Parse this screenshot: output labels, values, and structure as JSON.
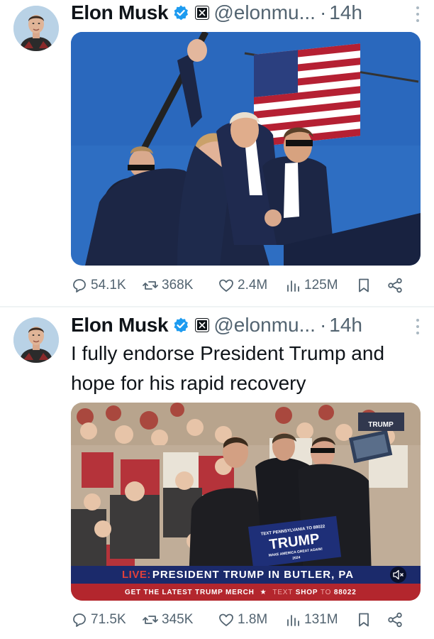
{
  "tweets": [
    {
      "author": {
        "name": "Elon Musk",
        "handle": "@elonmu...",
        "dot": "·",
        "time": "14h"
      },
      "text": "",
      "stats": {
        "replies": "54.1K",
        "reposts": "368K",
        "likes": "2.4M",
        "views": "125M"
      }
    },
    {
      "author": {
        "name": "Elon Musk",
        "handle": "@elonmu...",
        "dot": "·",
        "time": "14h"
      },
      "text": "I fully endorse President Trump and hope for his rapid recovery",
      "video": {
        "live_label": "LIVE:",
        "headline": "PRESIDENT TRUMP IN BUTLER, PA",
        "ticker_left": "GET THE LATEST TRUMP MERCH",
        "ticker_star": "★",
        "ticker_text": "TEXT",
        "ticker_shop": "SHOP",
        "ticker_to": "TO",
        "ticker_number": "88022",
        "sign_top": "TEXT PENNSYLVANIA TO 88022",
        "sign_main": "TRUMP",
        "sign_sub": "MAKE AMERICA GREAT AGAIN!",
        "sign_year": "2024",
        "corner_sign": "TRUMP"
      },
      "stats": {
        "replies": "71.5K",
        "reposts": "345K",
        "likes": "1.8M",
        "views": "131M"
      }
    }
  ],
  "colors": {
    "text": "#0f1419",
    "secondary": "#536471",
    "verified": "#1d9bf0",
    "divider": "#eff3f4",
    "news_bar": "#1b2a6b",
    "ticker": "#b3262d"
  }
}
